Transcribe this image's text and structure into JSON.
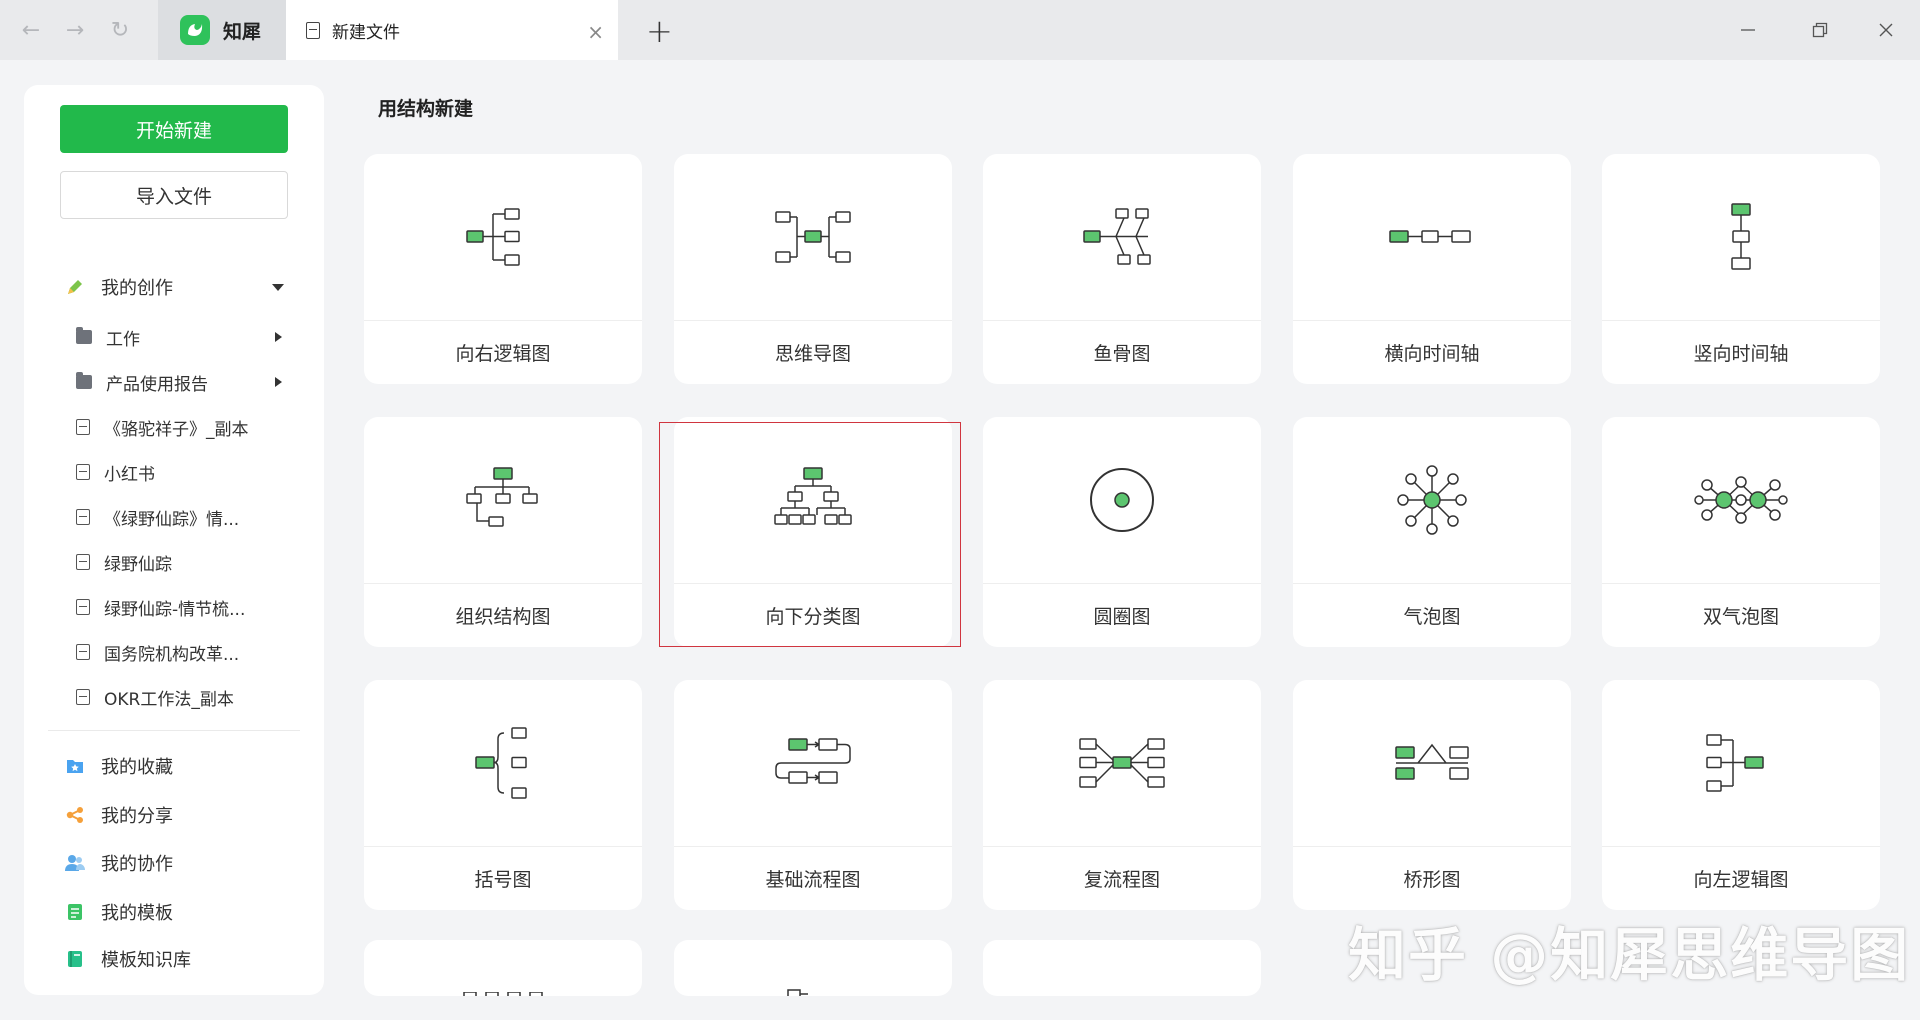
{
  "titlebar": {
    "app_name": "知犀",
    "tab_title": "新建文件",
    "new_tab_symbol": "+",
    "close_tab_symbol": "×"
  },
  "sidebar": {
    "start_new_label": "开始新建",
    "import_label": "导入文件",
    "my_creations": "我的创作",
    "folders": [
      {
        "label": "工作"
      },
      {
        "label": "产品使用报告"
      }
    ],
    "files": [
      {
        "label": "《骆驼祥子》_副本"
      },
      {
        "label": "小红书"
      },
      {
        "label": "《绿野仙踪》情..."
      },
      {
        "label": "绿野仙踪"
      },
      {
        "label": "绿野仙踪-情节梳..."
      },
      {
        "label": "国务院机构改革..."
      },
      {
        "label": "OKR工作法_副本"
      }
    ],
    "bottom_items": [
      {
        "label": "我的收藏",
        "icon": "favorites-icon",
        "color": "#4aa3f0"
      },
      {
        "label": "我的分享",
        "icon": "share-icon",
        "color": "#f5a03a"
      },
      {
        "label": "我的协作",
        "icon": "collaboration-icon",
        "color": "#5aa8e8"
      },
      {
        "label": "我的模板",
        "icon": "template-icon",
        "color": "#3cc466"
      },
      {
        "label": "模板知识库",
        "icon": "knowledge-base-icon",
        "color": "#27c08a"
      }
    ]
  },
  "main": {
    "section_title": "用结构新建",
    "structures": [
      {
        "label": "向右逻辑图",
        "icon": "right-logic-chart-icon"
      },
      {
        "label": "思维导图",
        "icon": "mind-map-icon"
      },
      {
        "label": "鱼骨图",
        "icon": "fishbone-icon"
      },
      {
        "label": "横向时间轴",
        "icon": "horizontal-timeline-icon"
      },
      {
        "label": "竖向时间轴",
        "icon": "vertical-timeline-icon"
      },
      {
        "label": "组织结构图",
        "icon": "org-chart-icon"
      },
      {
        "label": "向下分类图",
        "icon": "downward-tree-icon"
      },
      {
        "label": "圆圈图",
        "icon": "circle-map-icon"
      },
      {
        "label": "气泡图",
        "icon": "bubble-map-icon"
      },
      {
        "label": "双气泡图",
        "icon": "double-bubble-map-icon"
      },
      {
        "label": "括号图",
        "icon": "brace-map-icon"
      },
      {
        "label": "基础流程图",
        "icon": "basic-flowchart-icon"
      },
      {
        "label": "复流程图",
        "icon": "multi-flowchart-icon"
      },
      {
        "label": "桥形图",
        "icon": "bridge-map-icon"
      },
      {
        "label": "向左逻辑图",
        "icon": "left-logic-chart-icon"
      }
    ]
  },
  "colors": {
    "accent_green": "#22b94b",
    "node_green": "#5cc56f",
    "selection_red": "#d0353f"
  },
  "watermark": "知乎 @知犀思维导图"
}
